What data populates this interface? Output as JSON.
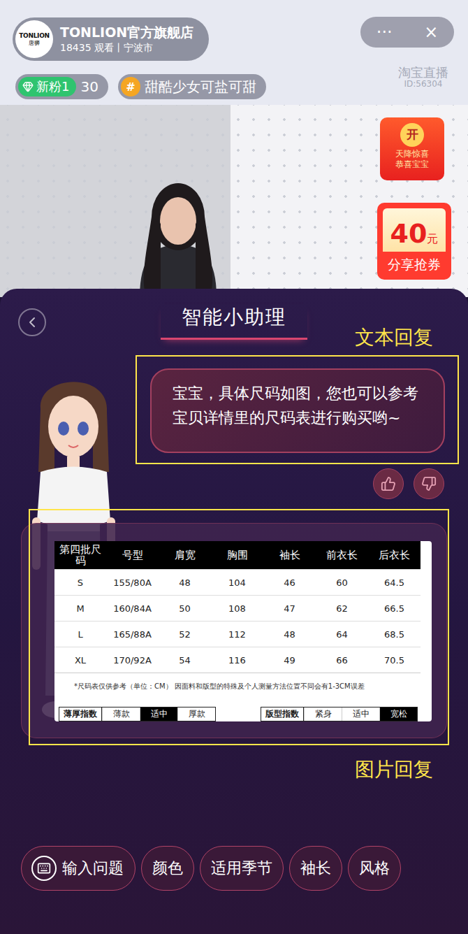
{
  "header": {
    "logo": {
      "name": "TONLION",
      "sub": "唐狮"
    },
    "store": "TONLION官方旗舰店",
    "meta": "18435 观看丨宁波市",
    "more": "···",
    "close": "×"
  },
  "tags": [
    {
      "kind": "fans",
      "label": "新粉1",
      "count": "30"
    },
    {
      "kind": "topic",
      "icon": "#",
      "label": "甜酷少女可盐可甜"
    }
  ],
  "watermark": {
    "brand": "淘宝直播",
    "id": "ID:56304"
  },
  "promos": [
    {
      "kind": "envelope",
      "icon": "开",
      "lines": [
        "天降惊喜",
        "恭喜宝宝"
      ]
    },
    {
      "kind": "coupon",
      "amount": "40",
      "unit": "元",
      "label": "分享抢券"
    }
  ],
  "assistant": {
    "title": "智能小助理"
  },
  "reply": {
    "text": "宝宝，具体尺码如图，您也可以参考宝贝详情里的尺码表进行购买哟~"
  },
  "size_chart": {
    "columns": [
      "第四批尺码",
      "号型",
      "肩宽",
      "胸围",
      "袖长",
      "前衣长",
      "后衣长"
    ],
    "rows": [
      [
        "S",
        "155/80A",
        "48",
        "104",
        "46",
        "60",
        "64.5"
      ],
      [
        "M",
        "160/84A",
        "50",
        "108",
        "47",
        "62",
        "66.5"
      ],
      [
        "L",
        "165/88A",
        "52",
        "112",
        "48",
        "64",
        "68.5"
      ],
      [
        "XL",
        "170/92A",
        "54",
        "116",
        "49",
        "66",
        "70.5"
      ]
    ],
    "note": "*尺码表仅供参考（单位：CM） 因面料和版型的特殊及个人测量方法位置不同会有1-3CM误差",
    "indices": [
      {
        "label": "薄厚指数",
        "options": [
          {
            "label": "薄款",
            "selected": false
          },
          {
            "label": "适中",
            "selected": true
          },
          {
            "label": "厚款",
            "selected": false
          }
        ]
      },
      {
        "label": "版型指数",
        "options": [
          {
            "label": "紧身",
            "selected": false
          },
          {
            "label": "适中",
            "selected": false
          },
          {
            "label": "宽松",
            "selected": true
          }
        ]
      }
    ]
  },
  "annotations": [
    {
      "label": "文本回复",
      "target": "reply"
    },
    {
      "label": "图片回复",
      "target": "image"
    }
  ],
  "quick_actions": [
    {
      "kind": "input",
      "label": "输入问题"
    },
    {
      "kind": "chip",
      "label": "颜色"
    },
    {
      "kind": "chip",
      "label": "适用季节"
    },
    {
      "kind": "chip",
      "label": "袖长"
    },
    {
      "kind": "chip",
      "label": "风格"
    }
  ]
}
